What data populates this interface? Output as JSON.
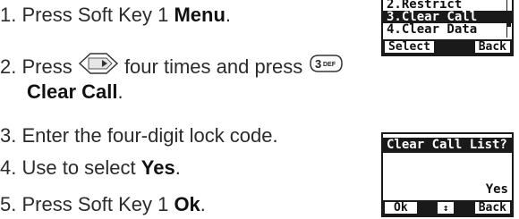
{
  "steps": [
    {
      "num": "1. ",
      "pre": "Press Soft Key 1 ",
      "bold": "Menu",
      "post": "."
    },
    {
      "num": "2. ",
      "pre": "Press ",
      "mid": " four times and press ",
      "bold": "Clear Call",
      "post": "."
    },
    {
      "num": "3. ",
      "text": "Enter the four-digit lock code."
    },
    {
      "num": "4. ",
      "pre": "Use to select ",
      "bold": "Yes",
      "post": "."
    },
    {
      "num": "5. ",
      "pre": "Press Soft Key 1 ",
      "bold": "Ok",
      "post": "."
    }
  ],
  "icons": {
    "nav_key": "navigation-key-icon",
    "key_3": "key-3-def-icon"
  },
  "screen1": {
    "rows": [
      "2.Restrict",
      "3.Clear Call",
      "4.Clear Data"
    ],
    "highlighted": 1,
    "softkeys": {
      "left": "Select",
      "right": "Back"
    }
  },
  "screen2": {
    "title": "Clear Call List?",
    "body": "Yes",
    "softkeys": {
      "left": "Ok",
      "mid": "↕",
      "right": "Back"
    }
  }
}
